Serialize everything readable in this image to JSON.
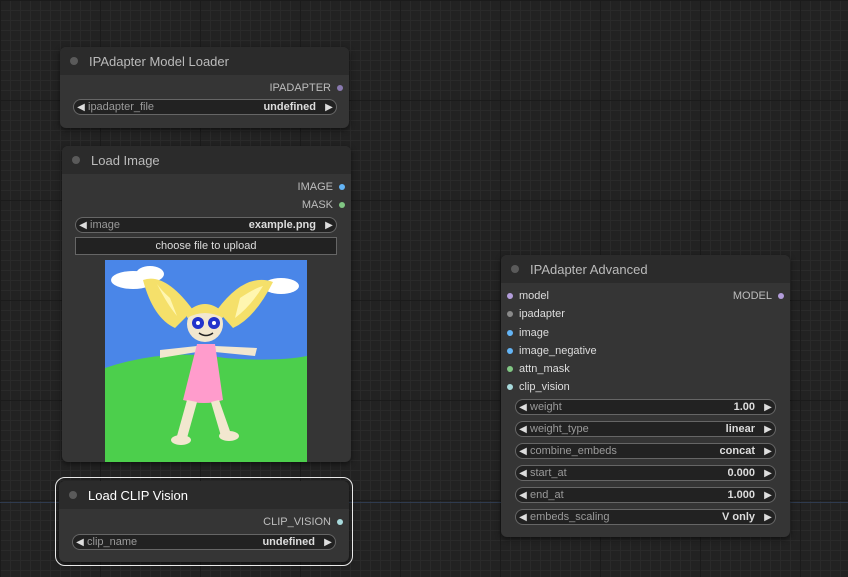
{
  "nodes": {
    "model_loader": {
      "title": "IPAdapter Model Loader",
      "outputs": [
        {
          "label": "IPADAPTER",
          "color": "#8a7ab0"
        }
      ],
      "widgets": [
        {
          "label": "ipadapter_file",
          "value": "undefined"
        }
      ]
    },
    "load_image": {
      "title": "Load Image",
      "outputs": [
        {
          "label": "IMAGE",
          "color": "#64b5f6"
        },
        {
          "label": "MASK",
          "color": "#81c784"
        }
      ],
      "widgets": [
        {
          "label": "image",
          "value": "example.png"
        }
      ],
      "upload_label": "choose file to upload"
    },
    "clip_vision": {
      "title": "Load CLIP Vision",
      "outputs": [
        {
          "label": "CLIP_VISION",
          "color": "#a8dadc"
        }
      ],
      "widgets": [
        {
          "label": "clip_name",
          "value": "undefined"
        }
      ]
    },
    "ipadapter_advanced": {
      "title": "IPAdapter Advanced",
      "inputs": [
        {
          "label": "model",
          "color": "#b39ddb"
        },
        {
          "label": "ipadapter",
          "color": "#8a8a8a"
        },
        {
          "label": "image",
          "color": "#64b5f6"
        },
        {
          "label": "image_negative",
          "color": "#64b5f6"
        },
        {
          "label": "attn_mask",
          "color": "#81c784"
        },
        {
          "label": "clip_vision",
          "color": "#a8dadc"
        }
      ],
      "outputs": [
        {
          "label": "MODEL",
          "color": "#b39ddb"
        }
      ],
      "widgets": [
        {
          "label": "weight",
          "value": "1.00"
        },
        {
          "label": "weight_type",
          "value": "linear"
        },
        {
          "label": "combine_embeds",
          "value": "concat"
        },
        {
          "label": "start_at",
          "value": "0.000"
        },
        {
          "label": "end_at",
          "value": "1.000"
        },
        {
          "label": "embeds_scaling",
          "value": "V only"
        }
      ]
    }
  },
  "icons": {
    "arrow_left": "◀",
    "arrow_right": "▶"
  }
}
